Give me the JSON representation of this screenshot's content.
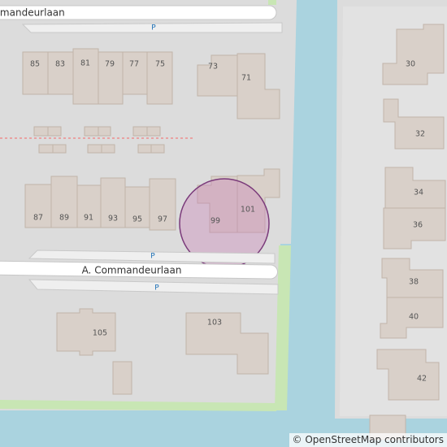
{
  "map": {
    "attribution": "© OpenStreetMap contributors",
    "colors": {
      "land": "#dcdcdc",
      "water": "#aad3df",
      "grass": "#c8e6b4",
      "building": "#d9d0c9",
      "building_outline": "#c1b4a9",
      "road": "#ffffff",
      "road_casing": "#c7c7c7",
      "parking": "#eeeeee",
      "marker_fill": "#c87ab4",
      "marker_stroke": "#7a3a7a"
    },
    "streets": [
      {
        "id": "street-top",
        "name": "mmandeurlaan"
      },
      {
        "id": "street-main",
        "name": "A. Commandeurlaan"
      }
    ],
    "parking_label": "P",
    "house_numbers": {
      "h85": "85",
      "h83": "83",
      "h81": "81",
      "h79": "79",
      "h77": "77",
      "h75": "75",
      "h73": "73",
      "h71": "71",
      "h87": "87",
      "h89": "89",
      "h91": "91",
      "h93": "93",
      "h95": "95",
      "h97": "97",
      "h99": "99",
      "h101": "101",
      "h103": "103",
      "h105": "105",
      "h30": "30",
      "h32": "32",
      "h34": "34",
      "h36": "36",
      "h38": "38",
      "h40": "40",
      "h42": "42"
    },
    "marker": {
      "label": "99",
      "description": "highlighted location"
    }
  }
}
